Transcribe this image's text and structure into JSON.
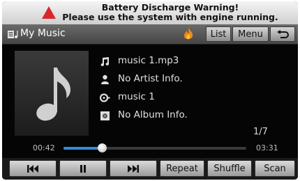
{
  "warning": {
    "line1": "Battery Discharge Warning!",
    "line2": "Please use the system with engine running."
  },
  "header": {
    "title": "My Music",
    "list_label": "List",
    "menu_label": "Menu"
  },
  "track": {
    "file": "music 1.mp3",
    "artist": "No Artist Info.",
    "title": "music 1",
    "album": "No Album Info."
  },
  "playback": {
    "position": "1/7",
    "elapsed": "00:42",
    "total": "03:31",
    "progress_fraction": 0.21,
    "accent_color": "#2f8de0"
  },
  "controls": {
    "repeat_label": "Repeat",
    "shuffle_label": "Shuffle",
    "scan_label": "Scan"
  },
  "icons": [
    "warning-triangle-icon",
    "music-folder-icon",
    "flame-icon",
    "back-arrow-icon",
    "music-note-icon",
    "artist-icon",
    "title-icon",
    "album-icon",
    "previous-icon",
    "pause-icon",
    "next-icon"
  ]
}
